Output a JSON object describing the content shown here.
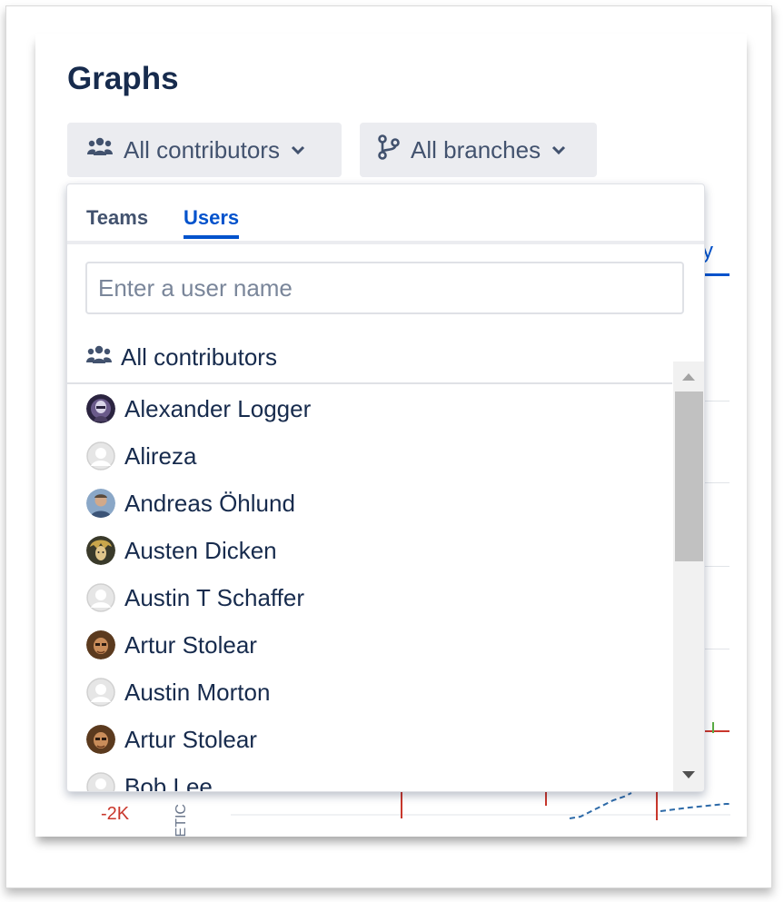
{
  "page": {
    "title": "Graphs"
  },
  "filters": {
    "contributors_label": "All contributors",
    "branches_label": "All branches"
  },
  "background": {
    "tab_fragment": "y",
    "axis_label": "-2K",
    "axis_title_fragment": "ETIC"
  },
  "dropdown": {
    "tabs": [
      {
        "label": "Teams",
        "active": false
      },
      {
        "label": "Users",
        "active": true
      }
    ],
    "search_placeholder": "Enter a user name",
    "all_contributors_label": "All contributors",
    "users": [
      {
        "name": "Alexander Logger",
        "avatar": "photo-dark-helmet"
      },
      {
        "name": "Alireza",
        "avatar": "default-user"
      },
      {
        "name": "Andreas Öhlund",
        "avatar": "photo-man-blue"
      },
      {
        "name": "Austen Dicken",
        "avatar": "photo-cartoon-hair"
      },
      {
        "name": "Austin T Schaffer",
        "avatar": "default-user"
      },
      {
        "name": "Artur Stolear",
        "avatar": "photo-man-brown"
      },
      {
        "name": "Austin Morton",
        "avatar": "default-user"
      },
      {
        "name": "Artur Stolear",
        "avatar": "photo-man-brown"
      },
      {
        "name": "Bob Lee",
        "avatar": "default-user"
      }
    ]
  },
  "colors": {
    "heading": "#172b4d",
    "link_active": "#0052cc",
    "button_bg": "#ebecf0",
    "chart_red": "#c9372c",
    "chart_blue": "#2d6aa8",
    "chart_green": "#5aac44"
  }
}
